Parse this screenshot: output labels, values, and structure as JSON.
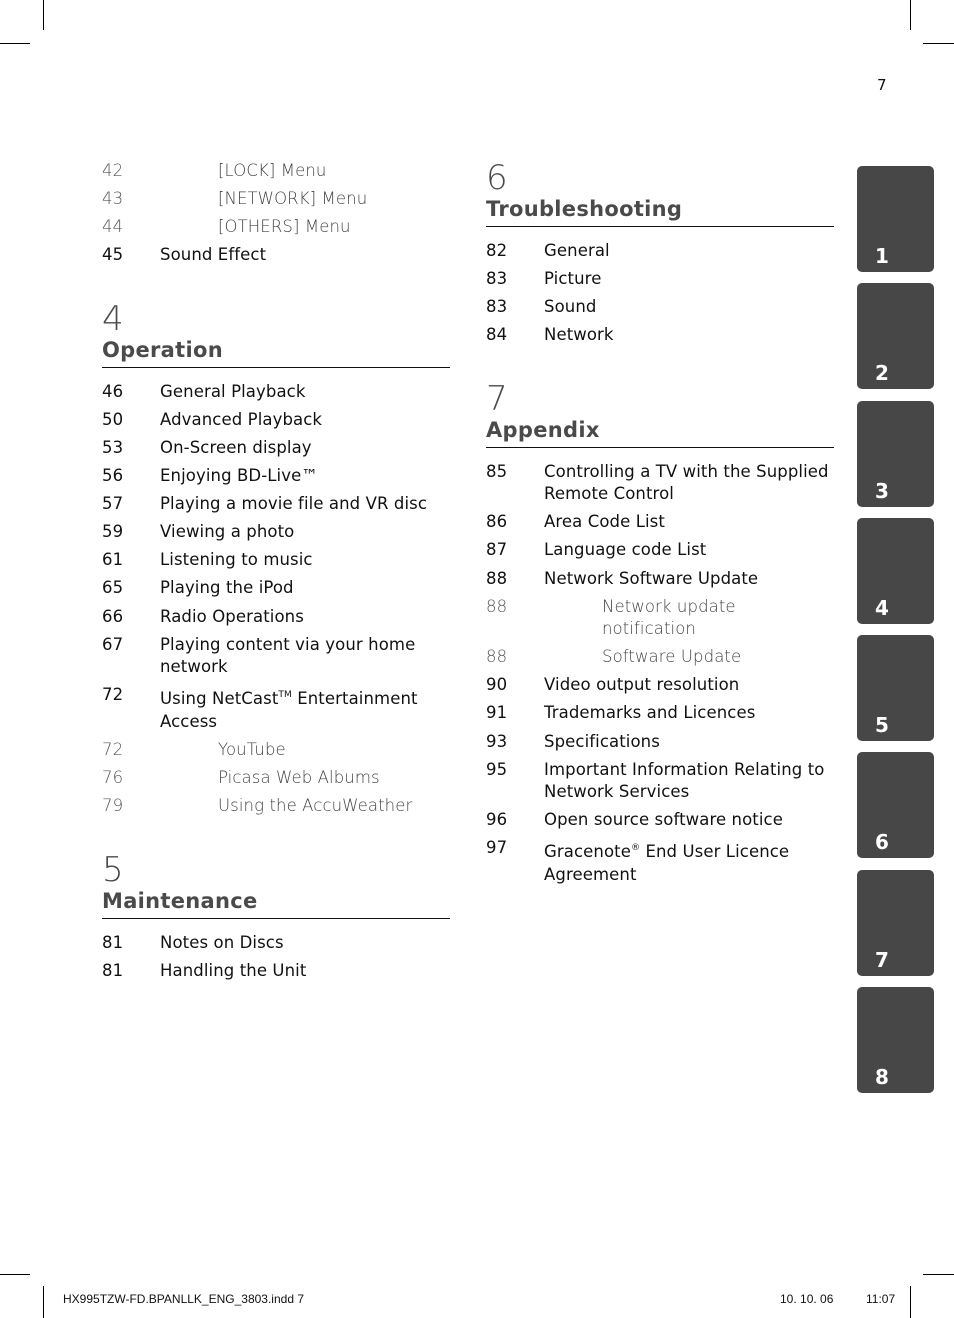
{
  "page_number": "7",
  "left_column": {
    "top_entries": [
      {
        "page": "42",
        "title": "[LOCK] Menu",
        "level": "sub"
      },
      {
        "page": "43",
        "title": "[NETWORK] Menu",
        "level": "sub"
      },
      {
        "page": "44",
        "title": "[OTHERS] Menu",
        "level": "sub"
      },
      {
        "page": "45",
        "title": "Sound Effect",
        "level": "main"
      }
    ],
    "sections": [
      {
        "number": "4",
        "title": "Operation",
        "entries": [
          {
            "page": "46",
            "title": "General Playback",
            "level": "main"
          },
          {
            "page": "50",
            "title": "Advanced Playback",
            "level": "main"
          },
          {
            "page": "53",
            "title": "On-Screen display",
            "level": "main"
          },
          {
            "page": "56",
            "title": "Enjoying BD-Live™",
            "level": "main"
          },
          {
            "page": "57",
            "title": "Playing a movie file and VR disc",
            "level": "main"
          },
          {
            "page": "59",
            "title": "Viewing a photo",
            "level": "main"
          },
          {
            "page": "61",
            "title": "Listening to music",
            "level": "main"
          },
          {
            "page": "65",
            "title": "Playing the iPod",
            "level": "main"
          },
          {
            "page": "66",
            "title": "Radio Operations",
            "level": "main"
          },
          {
            "page": "67",
            "title": "Playing content via your home network",
            "level": "main"
          },
          {
            "page": "72",
            "title_pre": "Using NetCast",
            "title_sup": "TM",
            "title_post": " Entertainment Access",
            "level": "main"
          },
          {
            "page": "72",
            "title": "YouTube",
            "level": "sub"
          },
          {
            "page": "76",
            "title": "Picasa Web Albums",
            "level": "sub"
          },
          {
            "page": "79",
            "title": "Using the AccuWeather",
            "level": "sub"
          }
        ]
      },
      {
        "number": "5",
        "title": "Maintenance",
        "entries": [
          {
            "page": "81",
            "title": "Notes on Discs",
            "level": "main"
          },
          {
            "page": "81",
            "title": "Handling the Unit",
            "level": "main"
          }
        ]
      }
    ]
  },
  "right_column": {
    "sections": [
      {
        "number": "6",
        "title": "Troubleshooting",
        "entries": [
          {
            "page": "82",
            "title": "General",
            "level": "main"
          },
          {
            "page": "83",
            "title": "Picture",
            "level": "main"
          },
          {
            "page": "83",
            "title": "Sound",
            "level": "main"
          },
          {
            "page": "84",
            "title": "Network",
            "level": "main"
          }
        ]
      },
      {
        "number": "7",
        "title": "Appendix",
        "entries": [
          {
            "page": "85",
            "title": "Controlling a TV with the Supplied Remote Control",
            "level": "main"
          },
          {
            "page": "86",
            "title": "Area Code List",
            "level": "main"
          },
          {
            "page": "87",
            "title": "Language code List",
            "level": "main"
          },
          {
            "page": "88",
            "title": "Network Software Update",
            "level": "main"
          },
          {
            "page": "88",
            "title": "Network update notification",
            "level": "sub"
          },
          {
            "page": "88",
            "title": "Software Update",
            "level": "sub"
          },
          {
            "page": "90",
            "title": "Video output resolution",
            "level": "main"
          },
          {
            "page": "91",
            "title": "Trademarks and Licences",
            "level": "main"
          },
          {
            "page": "93",
            "title": "Specifications",
            "level": "main"
          },
          {
            "page": "95",
            "title": "Important Information Relating to Network Services",
            "level": "main"
          },
          {
            "page": "96",
            "title": "Open source software notice",
            "level": "main"
          },
          {
            "page": "97",
            "title_pre": "Gracenote",
            "title_sup": "®",
            "title_post": " End User Licence Agreement",
            "level": "main"
          }
        ]
      }
    ]
  },
  "chapter_tabs": [
    "1",
    "2",
    "3",
    "4",
    "5",
    "6",
    "7",
    "8"
  ],
  "colors": {
    "tab_bg": "#474747",
    "tab_text": "#ffffff",
    "heading": "#4a4a4a"
  },
  "footer": {
    "file_name": "HX995TZW-FD.BPANLLK_ENG_3803.indd   7",
    "date": "10. 10. 06",
    "time": "11:07"
  }
}
